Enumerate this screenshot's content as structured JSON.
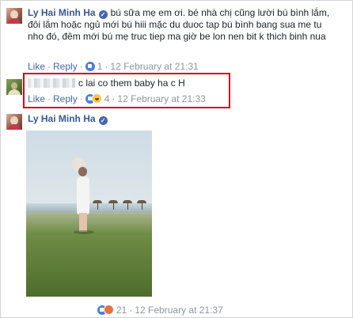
{
  "comments": [
    {
      "author": "Ly Hai Minh Ha",
      "text": "bú sữa mẹ em ơi. bé nhà chị cũng lười bú bình lắm, đôi lắm hoặc ngủ mới bú hiii mặc du duoc tap bú bình bang sua me tu nho đó, đêm mới bú mẹ truc tiep ma giờ be lon nen bit k thich binh nua",
      "like_label": "Like",
      "reply_label": "Reply",
      "reaction_count": "1",
      "timestamp": "12 February at 21:31"
    },
    {
      "author": "",
      "text": "c lai co them baby ha c H",
      "like_label": "Like",
      "reply_label": "Reply",
      "reaction_count": "4",
      "timestamp": "12 February at 21:33"
    },
    {
      "author": "Ly Hai Minh Ha",
      "text": "",
      "reaction_count": "21",
      "timestamp": "12 February at 21:37"
    }
  ],
  "separator": "·",
  "colors": {
    "link": "#4267b2",
    "author": "#365899",
    "meta": "#90949c",
    "highlight": "#d0021b"
  },
  "icons": [
    "verified-badge-icon",
    "like-reaction-icon",
    "haha-reaction-icon",
    "angry-reaction-icon"
  ]
}
